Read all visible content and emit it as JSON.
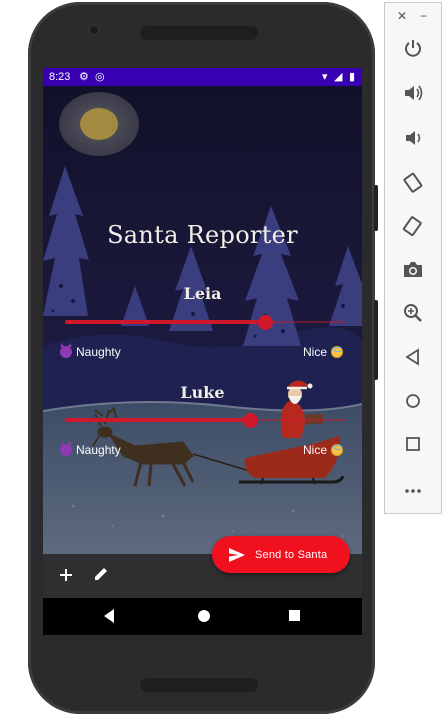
{
  "status_bar": {
    "time": "8:23",
    "bg_color": "#3700b3"
  },
  "app": {
    "title": "Santa Reporter",
    "children": [
      {
        "name": "Leia",
        "value": 0.71,
        "naughty_label": "Naughty",
        "nice_label": "Nice"
      },
      {
        "name": "Luke",
        "value": 0.65,
        "naughty_label": "Naughty",
        "nice_label": "Nice"
      }
    ],
    "accent_color": "#d0182a",
    "fab": {
      "label": "Send to Santa",
      "icon": "send-icon",
      "color": "#f0101e"
    },
    "bottom_bar": {
      "icons": [
        "add-icon",
        "edit-icon"
      ]
    }
  },
  "emulator_toolbar": {
    "icons": [
      "close-icon",
      "minimize-icon",
      "power-icon",
      "volume-up-icon",
      "volume-down-icon",
      "rotate-left-icon",
      "rotate-right-icon",
      "camera-icon",
      "zoom-icon",
      "back-icon",
      "home-icon",
      "overview-icon",
      "more-icon"
    ]
  }
}
